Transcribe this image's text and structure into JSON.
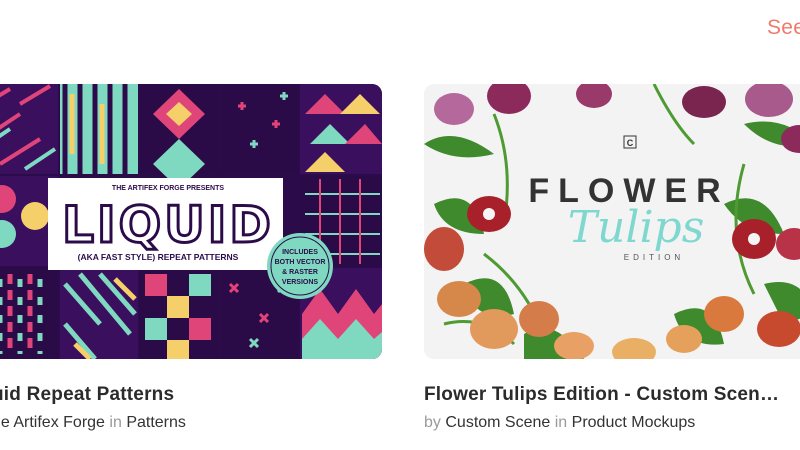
{
  "section": {
    "see_all_label": "See"
  },
  "cards": [
    {
      "title": "uid Repeat Patterns",
      "by_prefix": "",
      "author": "he Artifex Forge",
      "in_label": "in",
      "category": "Patterns",
      "thumbnail": {
        "kicker": "THE ARTIFEX FORGE PRESENTS",
        "headline": "LIQUID",
        "subline": "(AKA FAST STYLE) REPEAT PATTERNS",
        "badge": "INCLUDES BOTH VECTOR & RASTER VERSIONS",
        "colors": {
          "background": "#2c0b4a",
          "accent_teal": "#7fd9c1",
          "accent_pink": "#e0457a",
          "accent_yellow": "#f5d06a"
        }
      }
    },
    {
      "title": "Flower Tulips Edition - Custom Scen…",
      "by_prefix": "by",
      "author": "Custom Scene",
      "in_label": "in",
      "category": "Product Mockups",
      "thumbnail": {
        "logo": "C",
        "headline": "FLOWER",
        "script": "Tulips",
        "subline": "EDITION",
        "colors": {
          "background": "#f4f3f3",
          "script": "#7fd8cf",
          "petal": "#8c2a5c"
        }
      }
    }
  ]
}
